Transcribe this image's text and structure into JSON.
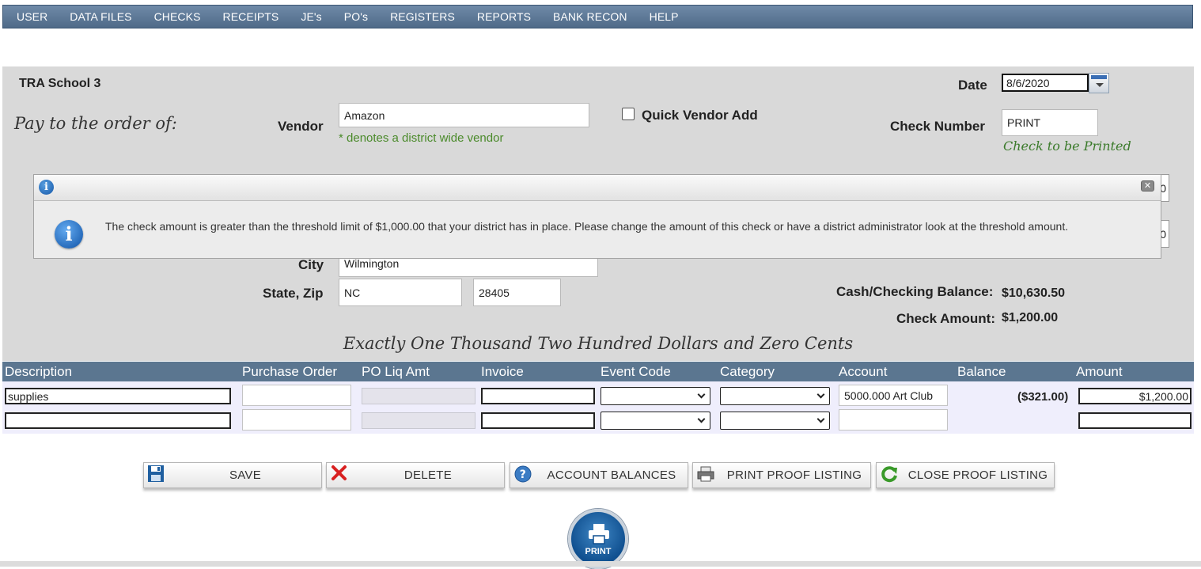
{
  "nav": {
    "items": [
      "USER",
      "DATA FILES",
      "CHECKS",
      "RECEIPTS",
      "JE's",
      "PO's",
      "REGISTERS",
      "REPORTS",
      "BANK RECON",
      "HELP"
    ]
  },
  "check": {
    "school": "TRA School 3",
    "pay_to_label": "Pay to the order of:",
    "vendor_label": "Vendor",
    "vendor_value": "Amazon",
    "district_note": "* denotes a district wide vendor",
    "quick_vendor_label": "Quick Vendor Add",
    "date_label": "Date",
    "date_value": "8/6/2020",
    "check_number_label": "Check Number",
    "check_number_value": "PRINT",
    "check_printed_note": "Check to be Printed",
    "partial_field_1": "0",
    "partial_field_2": "0",
    "city_label": "City",
    "city_value": "Wilmington",
    "state_zip_label": "State, Zip",
    "state_value": "NC",
    "zip_value": "28405",
    "cash_balance_label": "Cash/Checking Balance:",
    "cash_balance_value": "$10,630.50",
    "check_amount_label": "Check Amount:",
    "check_amount_value": "$1,200.00",
    "amount_words": "Exactly One Thousand Two Hundred Dollars and Zero Cents"
  },
  "grid": {
    "headers": [
      "Description",
      "Purchase Order",
      "PO Liq Amt",
      "Invoice",
      "Event Code",
      "Category",
      "Account",
      "Balance",
      "Amount"
    ],
    "rows": [
      {
        "description": "supplies",
        "account": "5000.000 Art Club",
        "balance": "($321.00)",
        "amount": "$1,200.00"
      },
      {
        "description": "",
        "account": "",
        "balance": "",
        "amount": ""
      }
    ]
  },
  "buttons": {
    "save": "SAVE",
    "delete": "DELETE",
    "account_balances": "ACCOUNT BALANCES",
    "print_proof": "PRINT PROOF LISTING",
    "close_proof": "CLOSE PROOF LISTING",
    "print": "PRINT"
  },
  "dialog": {
    "message": "The check amount is greater than the threshold limit of $1,000.00 that your district has in place. Please change the amount of this check or have a district administrator look at the threshold amount."
  },
  "icons": {
    "save": "floppy-disk-icon",
    "delete": "red-x-icon",
    "account_balances": "help-circle-icon",
    "print_proof": "printer-icon",
    "close_proof": "refresh-icon",
    "info": "info-icon"
  },
  "colors": {
    "nav_bg": "#5b7690",
    "panel_bg": "#d9d9d9",
    "green_note": "#4a8a2a",
    "grid_header": "#5b7690",
    "info_blue": "#1356a8"
  }
}
